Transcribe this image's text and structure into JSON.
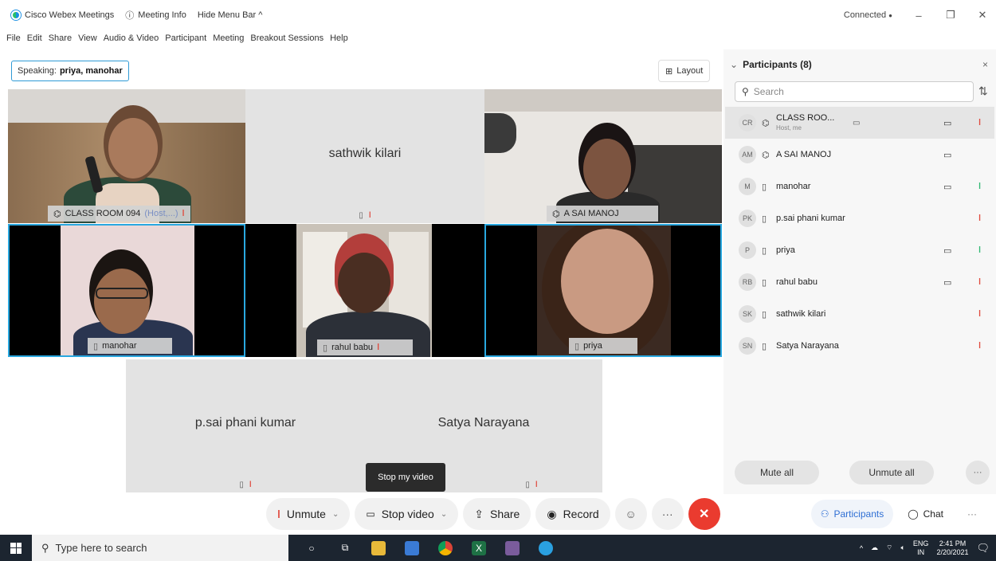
{
  "titlebar": {
    "app_title": "Cisco Webex Meetings",
    "meeting_info": "Meeting Info",
    "hide_menu": "Hide Menu Bar ^",
    "connected": "Connected",
    "minimize": "–",
    "restore": "❐",
    "close": "✕"
  },
  "menu": [
    "File",
    "Edit",
    "Share",
    "View",
    "Audio & Video",
    "Participant",
    "Meeting",
    "Breakout Sessions",
    "Help"
  ],
  "speaking": {
    "label": "Speaking:",
    "names": "priya, manohar"
  },
  "layout_label": "Layout",
  "tiles": {
    "classroom": "CLASS ROOM 094",
    "classroom_host": "(Host,...)",
    "sathwik": "sathwik kilari",
    "asai": "A SAI MANOJ",
    "manohar": "manohar",
    "rahul": "rahul babu",
    "priya": "priya",
    "psai": "p.sai phani kumar",
    "satya": "Satya Narayana"
  },
  "tooltip": "Stop my video",
  "toolbar": {
    "unmute": "Unmute",
    "stop_video": "Stop video",
    "share": "Share",
    "record": "Record",
    "more": "···",
    "end": "✕",
    "participants": "Participants",
    "chat": "Chat",
    "more_right": "···"
  },
  "panel": {
    "title": "Participants (8)",
    "close": "×",
    "search_placeholder": "Search",
    "mute_all": "Mute all",
    "unmute_all": "Unmute all",
    "more": "···",
    "participants": [
      {
        "initials": "CR",
        "name": "CLASS ROO...",
        "sub": "Host, me",
        "camera": true,
        "mic": "muted",
        "selected": true
      },
      {
        "initials": "AM",
        "name": "A SAI MANOJ",
        "sub": "",
        "camera": true,
        "mic": "none",
        "selected": false
      },
      {
        "initials": "M",
        "name": "manohar",
        "sub": "",
        "camera": true,
        "mic": "active",
        "selected": false
      },
      {
        "initials": "PK",
        "name": "p.sai phani kumar",
        "sub": "",
        "camera": false,
        "mic": "muted",
        "selected": false
      },
      {
        "initials": "P",
        "name": "priya",
        "sub": "",
        "camera": true,
        "mic": "active",
        "selected": false
      },
      {
        "initials": "RB",
        "name": "rahul babu",
        "sub": "",
        "camera": true,
        "mic": "muted",
        "selected": false
      },
      {
        "initials": "SK",
        "name": "sathwik kilari",
        "sub": "",
        "camera": false,
        "mic": "muted",
        "selected": false
      },
      {
        "initials": "SN",
        "name": "Satya Narayana",
        "sub": "",
        "camera": false,
        "mic": "muted",
        "selected": false
      }
    ]
  },
  "taskbar": {
    "search_placeholder": "Type here to search",
    "lang_top": "ENG",
    "lang_bottom": "IN",
    "time": "2:41 PM",
    "date": "2/20/2021"
  },
  "colors": {
    "active_border": "#29a8e0",
    "mute_red": "#e0483c",
    "mic_green": "#2eb872",
    "end_red": "#ea3b2f",
    "taskbar": "#1c2530"
  }
}
